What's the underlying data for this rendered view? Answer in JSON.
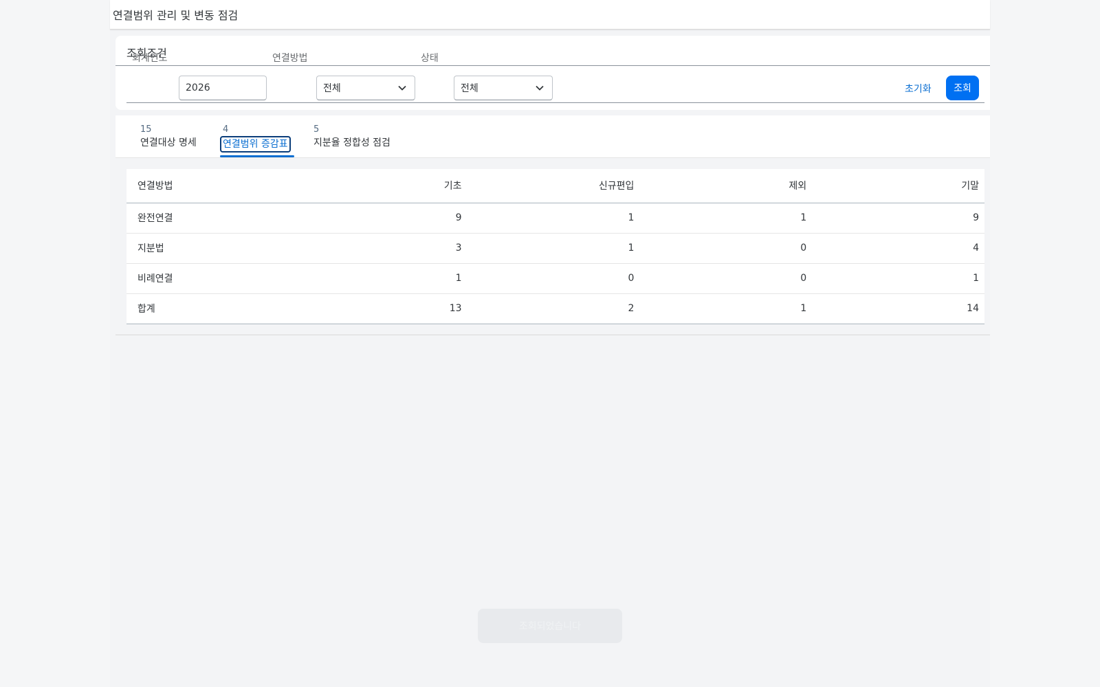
{
  "page": {
    "title": "연결범위 관리 및 변동 점검"
  },
  "filters": {
    "section_title": "조회조건",
    "year_label": "회계연도",
    "year_value": "2026",
    "method_label": "연결방법",
    "method_value": "전체",
    "status_label": "상태",
    "status_value": "전체",
    "reset_label": "초기화",
    "search_label": "조회"
  },
  "tabs": [
    {
      "count": "15",
      "label": "연결대상 명세"
    },
    {
      "count": "4",
      "label": "연결범위 증감표"
    },
    {
      "count": "5",
      "label": "지분율 정합성 점검"
    }
  ],
  "table": {
    "headers": [
      "연결방법",
      "기초",
      "신규편입",
      "제외",
      "기말"
    ],
    "rows": [
      [
        "완전연결",
        "9",
        "1",
        "1",
        "9"
      ],
      [
        "지분법",
        "3",
        "1",
        "0",
        "4"
      ],
      [
        "비례연결",
        "1",
        "0",
        "0",
        "1"
      ]
    ],
    "total": [
      "합계",
      "13",
      "2",
      "1",
      "14"
    ]
  },
  "toast": {
    "message": "조회되었습니다"
  }
}
